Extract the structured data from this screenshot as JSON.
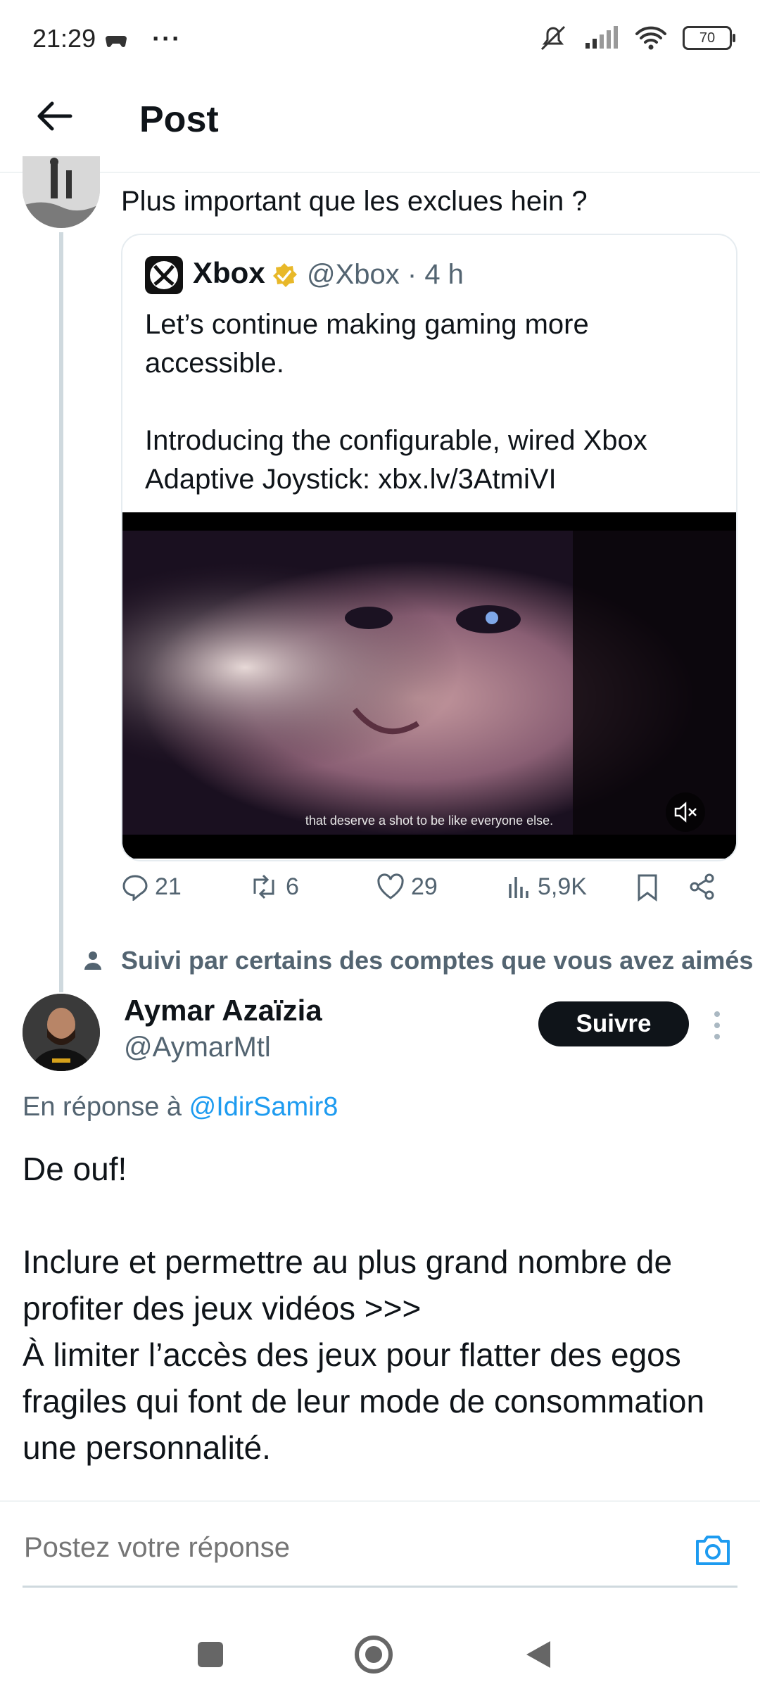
{
  "status_bar": {
    "time": "21:29",
    "ellipsis": "···",
    "battery": "70"
  },
  "header": {
    "title": "Post"
  },
  "post1": {
    "text": "Plus important que les exclues hein ?"
  },
  "quoted": {
    "name": "Xbox",
    "handle_time": "@Xbox · 4 h",
    "text": "Let’s continue making gaming more accessible.\n\nIntroducing the configurable, wired Xbox Adaptive Joystick: xbx.lv/3AtmiVI",
    "video_subtitle": "that deserve a shot to be like everyone else."
  },
  "actions": {
    "replies": "21",
    "reposts": "6",
    "likes": "29",
    "views": "5,9K"
  },
  "social_context": "Suivi par certains des comptes que vous avez aimés",
  "post2": {
    "name": "Aymar Azaïzia",
    "handle": "@AymarMtl",
    "follow_label": "Suivre",
    "reply_prefix": "En réponse à",
    "reply_mention": "@IdirSamir8",
    "text": "De ouf!\n\nInclure et permettre au plus grand nombre de profiter des jeux vidéos >>>\nÀ limiter l’accès des jeux pour flatter des egos fragiles qui font de leur mode de consommation une personnalité."
  },
  "reply_box": {
    "placeholder": "Postez votre réponse"
  },
  "colors": {
    "accent": "#1d9bf0",
    "verified": "#e8b829"
  }
}
